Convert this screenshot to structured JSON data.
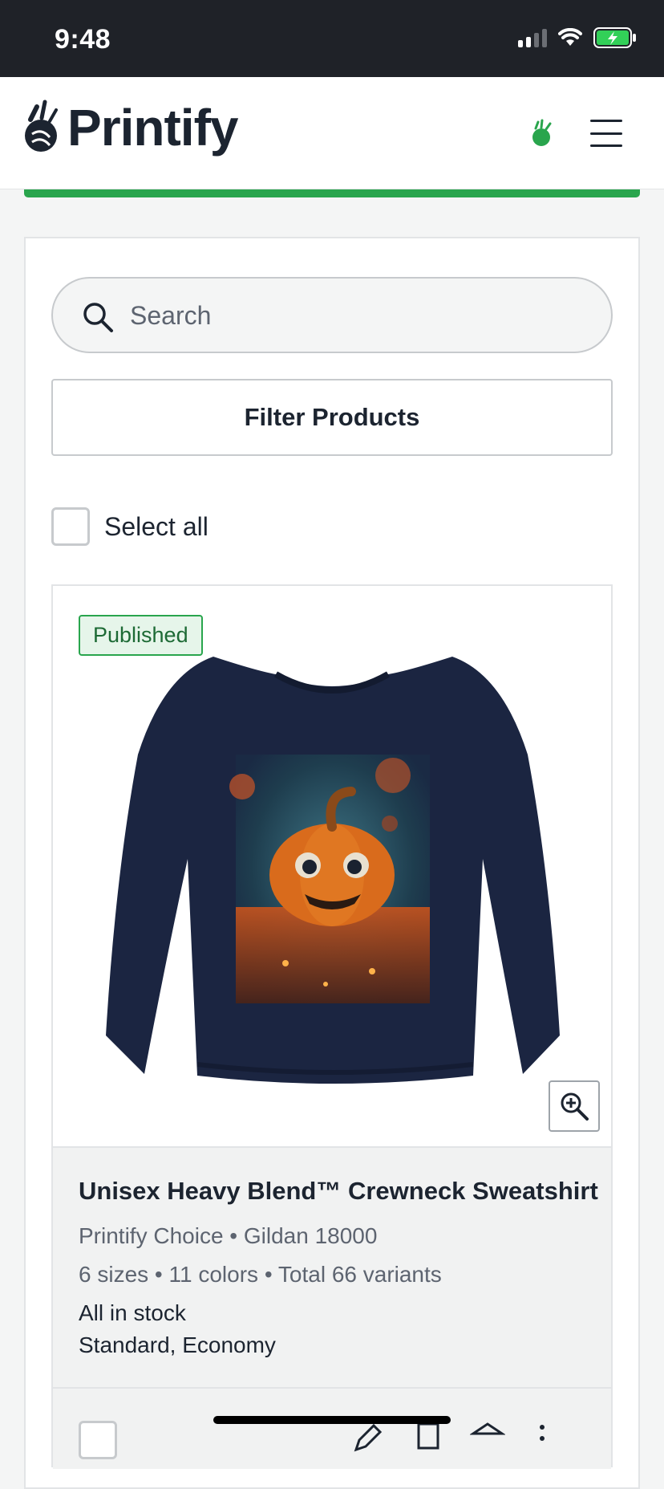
{
  "status_bar": {
    "time": "9:48"
  },
  "header": {
    "logo_text": "Printify",
    "icons": [
      "printify-hand-icon",
      "menu-icon"
    ]
  },
  "search": {
    "placeholder": "Search"
  },
  "filter": {
    "label": "Filter Products"
  },
  "select_all": {
    "label": "Select all"
  },
  "product": {
    "status": "Published",
    "title": "Unisex Heavy Blend™ Crewneck Sweatshirt",
    "provider": "Printify Choice • Gildan 18000",
    "variants": "6 sizes • 11 colors • Total 66 variants",
    "stock": "All in stock",
    "shipping": "Standard, Economy"
  },
  "colors": {
    "brand_green": "#29a54d",
    "text_dark": "#1c2430",
    "text_muted": "#5d6470"
  }
}
